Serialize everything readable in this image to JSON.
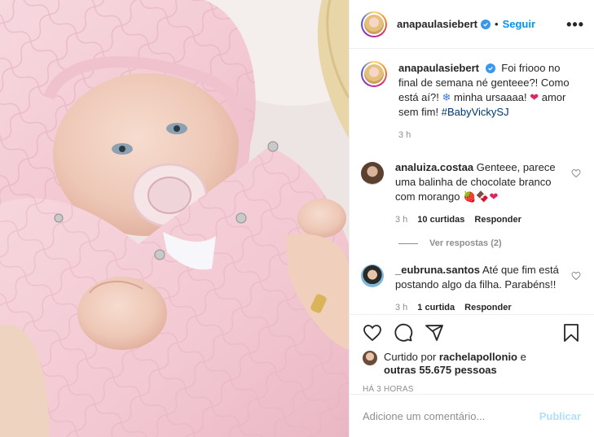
{
  "post": {
    "username": "anapaulasiebert",
    "follow_label": "Seguir",
    "separator": "•",
    "more_label": "•••"
  },
  "caption": {
    "username": "anapaulasiebert",
    "text_part1": "Foi friooo no final de semana né genteee?! Como está aí?! ",
    "text_part2": " minha ursaaaa! ",
    "text_part3": " amor sem fim! ",
    "snowflake": "❄",
    "heart": "❤",
    "hashtag": "#BabyVickySJ",
    "time": "3 h"
  },
  "comments": [
    {
      "username": "analuiza.costaa",
      "text": "Genteee, parece uma balinha de chocolate branco com morango ",
      "emojis": "🍓🍫❤",
      "time": "3 h",
      "likes": "10 curtidas",
      "reply": "Responder",
      "view_replies": "Ver respostas (2)"
    },
    {
      "username": "_eubruna.santos",
      "text": "Até que fim está postando algo da filha. Parabéns!!",
      "time": "3 h",
      "likes": "1 curtida",
      "reply": "Responder"
    }
  ],
  "likes": {
    "prefix": "Curtido por ",
    "user": "rachelapollonio",
    "middle": " e",
    "others": "outras 55.675 pessoas"
  },
  "timestamp": "HÁ 3 HORAS",
  "comment_input": {
    "placeholder": "Adicione um comentário...",
    "publish_label": "Publicar"
  },
  "colors": {
    "accent": "#0095f6",
    "publish_disabled": "#b2dffc",
    "verified": "#3897f0",
    "heart_red": "#ed4956"
  },
  "icons": [
    "more-icon",
    "verified-icon",
    "heart-icon",
    "comment-icon",
    "share-icon",
    "bookmark-icon"
  ]
}
